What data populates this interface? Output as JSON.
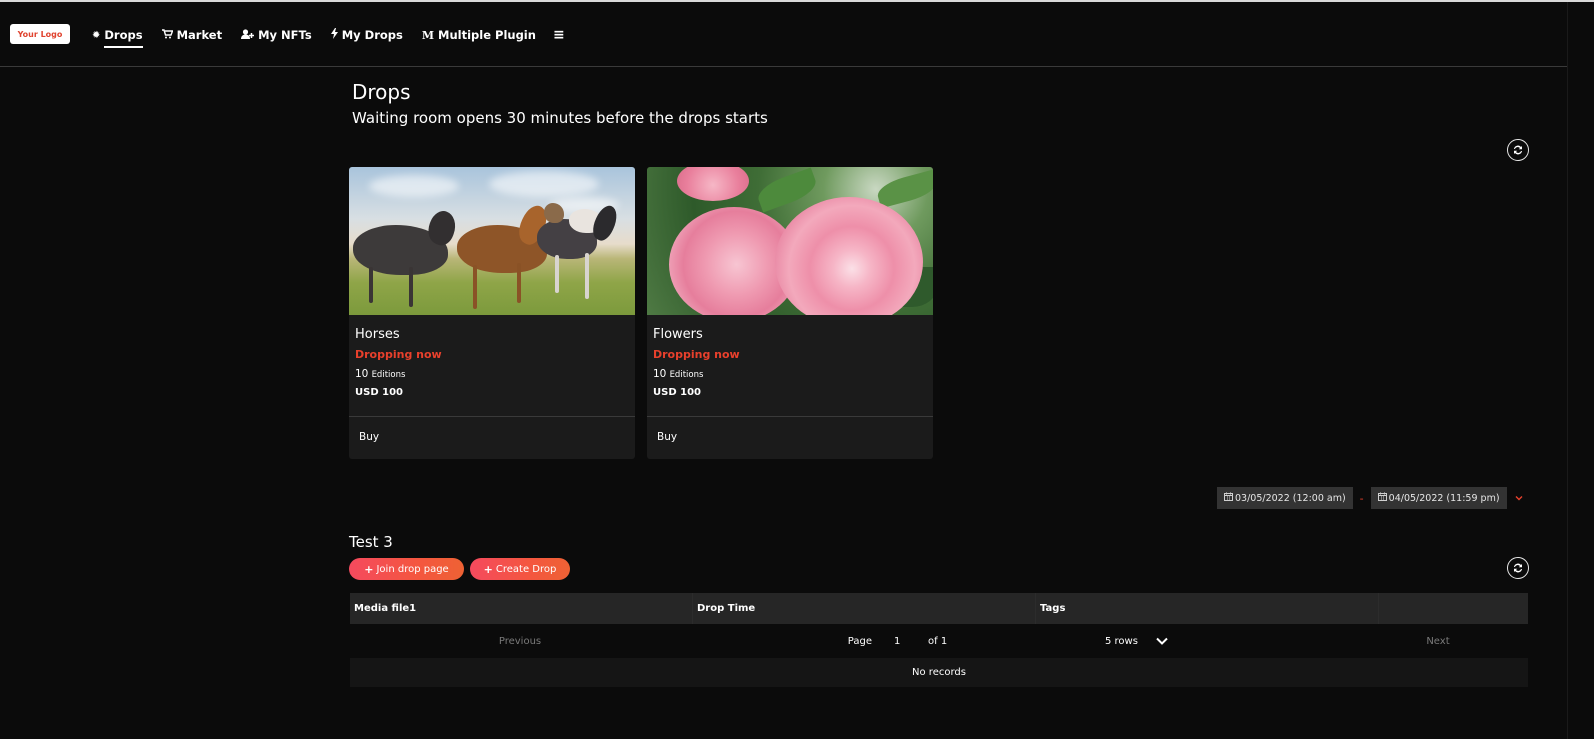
{
  "navbar": {
    "logo": "Your Logo",
    "items": [
      {
        "label": "Drops",
        "icon": "drops-icon",
        "glyph": "✹",
        "active": true
      },
      {
        "label": "Market",
        "icon": "cart-icon",
        "glyph": "🛒",
        "active": false
      },
      {
        "label": "My NFTs",
        "icon": "user-plus-icon",
        "glyph": "👤",
        "active": false
      },
      {
        "label": "My Drops",
        "icon": "bolt-icon",
        "glyph": "ϟ",
        "active": false
      },
      {
        "label": "Multiple Plugin",
        "icon": "m-icon",
        "glyph": "M",
        "active": false
      }
    ],
    "menu_icon": "≡"
  },
  "header": {
    "title": "Drops",
    "subtitle": "Waiting room opens 30 minutes before the drops starts"
  },
  "refresh_glyph": "⟳",
  "cards": [
    {
      "title": "Horses",
      "status": "Dropping now",
      "editions_count": "10",
      "editions_label": "Editions",
      "price": "USD 100",
      "action": "Buy",
      "image": "horses"
    },
    {
      "title": "Flowers",
      "status": "Dropping now",
      "editions_count": "10",
      "editions_label": "Editions",
      "price": "USD 100",
      "action": "Buy",
      "image": "flowers"
    }
  ],
  "date_filter": {
    "start": "03/05/2022 (12:00 am)",
    "separator": "-",
    "end": "04/05/2022 (11:59 pm)",
    "calendar_glyph": "▦",
    "chevron": "⌄"
  },
  "section": {
    "title": "Test 3",
    "buttons": {
      "join": "Join drop page",
      "create": "Create Drop",
      "plus": "+"
    }
  },
  "table": {
    "columns": [
      "Media file1",
      "Drop Time",
      "Tags",
      ""
    ],
    "pagination": {
      "previous": "Previous",
      "page_label": "Page",
      "page": "1",
      "of_label": "of 1",
      "rows": "5 rows",
      "next": "Next"
    },
    "empty_text": "No records"
  },
  "colors": {
    "accent": "#e8402c",
    "background": "#0b0b0b",
    "card": "#1b1b1b",
    "button_gradient_start": "#f54a5e",
    "button_gradient_end": "#ee6234"
  }
}
